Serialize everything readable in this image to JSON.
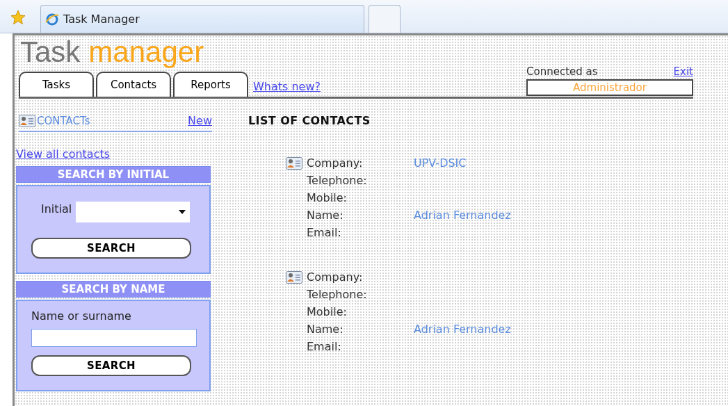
{
  "browser": {
    "tab_title": "Task Manager"
  },
  "header": {
    "title_first": "Task",
    "title_second": "manager",
    "tabs": [
      {
        "label": "Tasks"
      },
      {
        "label": "Contacts"
      },
      {
        "label": "Reports"
      }
    ],
    "whats_new": "Whats new?",
    "connected_as": "Connected as",
    "exit": "Exit",
    "user": "Administrador"
  },
  "sidebar": {
    "section_title": "CONTACTs",
    "new_link": "New",
    "view_all": "View all contacts",
    "search_initial": {
      "title": "SEARCH BY INITIAL",
      "label": "Initial",
      "button": "SEARCH"
    },
    "search_name": {
      "title": "SEARCH BY NAME",
      "label": "Name or surname",
      "button": "SEARCH"
    }
  },
  "main": {
    "title": "LIST OF CONTACTS",
    "contacts": [
      {
        "fields": [
          {
            "label": "Company:",
            "value": "UPV-DSIC"
          },
          {
            "label": "Telephone:"
          },
          {
            "label": "Mobile:"
          },
          {
            "label": "Name:",
            "value": "Adrian Fernandez"
          },
          {
            "label": "Email:"
          }
        ]
      },
      {
        "fields": [
          {
            "label": "Company:"
          },
          {
            "label": "Telephone:"
          },
          {
            "label": "Mobile:"
          },
          {
            "label": "Name:",
            "value": "Adrian Fernandez"
          },
          {
            "label": "Email:"
          }
        ]
      }
    ]
  }
}
